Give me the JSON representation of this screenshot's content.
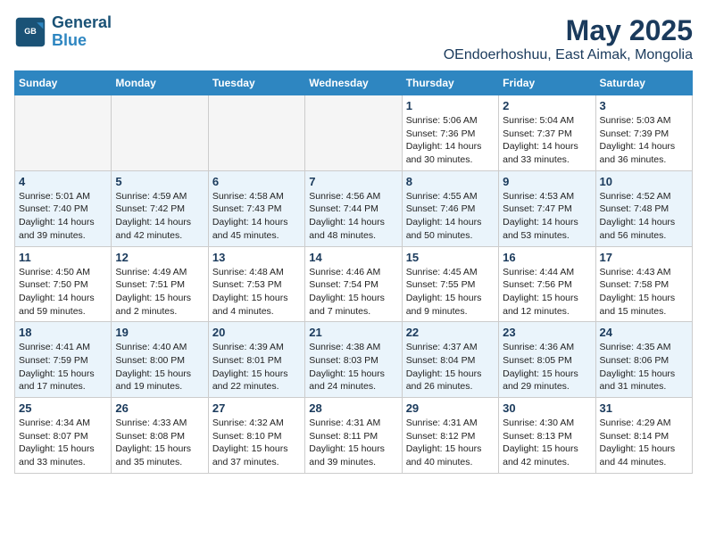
{
  "header": {
    "logo_line1": "General",
    "logo_line2": "Blue",
    "month_title": "May 2025",
    "location": "OEndoerhoshuu, East Aimak, Mongolia"
  },
  "weekdays": [
    "Sunday",
    "Monday",
    "Tuesday",
    "Wednesday",
    "Thursday",
    "Friday",
    "Saturday"
  ],
  "weeks": [
    [
      {
        "day": "",
        "info": ""
      },
      {
        "day": "",
        "info": ""
      },
      {
        "day": "",
        "info": ""
      },
      {
        "day": "",
        "info": ""
      },
      {
        "day": "1",
        "info": "Sunrise: 5:06 AM\nSunset: 7:36 PM\nDaylight: 14 hours\nand 30 minutes."
      },
      {
        "day": "2",
        "info": "Sunrise: 5:04 AM\nSunset: 7:37 PM\nDaylight: 14 hours\nand 33 minutes."
      },
      {
        "day": "3",
        "info": "Sunrise: 5:03 AM\nSunset: 7:39 PM\nDaylight: 14 hours\nand 36 minutes."
      }
    ],
    [
      {
        "day": "4",
        "info": "Sunrise: 5:01 AM\nSunset: 7:40 PM\nDaylight: 14 hours\nand 39 minutes."
      },
      {
        "day": "5",
        "info": "Sunrise: 4:59 AM\nSunset: 7:42 PM\nDaylight: 14 hours\nand 42 minutes."
      },
      {
        "day": "6",
        "info": "Sunrise: 4:58 AM\nSunset: 7:43 PM\nDaylight: 14 hours\nand 45 minutes."
      },
      {
        "day": "7",
        "info": "Sunrise: 4:56 AM\nSunset: 7:44 PM\nDaylight: 14 hours\nand 48 minutes."
      },
      {
        "day": "8",
        "info": "Sunrise: 4:55 AM\nSunset: 7:46 PM\nDaylight: 14 hours\nand 50 minutes."
      },
      {
        "day": "9",
        "info": "Sunrise: 4:53 AM\nSunset: 7:47 PM\nDaylight: 14 hours\nand 53 minutes."
      },
      {
        "day": "10",
        "info": "Sunrise: 4:52 AM\nSunset: 7:48 PM\nDaylight: 14 hours\nand 56 minutes."
      }
    ],
    [
      {
        "day": "11",
        "info": "Sunrise: 4:50 AM\nSunset: 7:50 PM\nDaylight: 14 hours\nand 59 minutes."
      },
      {
        "day": "12",
        "info": "Sunrise: 4:49 AM\nSunset: 7:51 PM\nDaylight: 15 hours\nand 2 minutes."
      },
      {
        "day": "13",
        "info": "Sunrise: 4:48 AM\nSunset: 7:53 PM\nDaylight: 15 hours\nand 4 minutes."
      },
      {
        "day": "14",
        "info": "Sunrise: 4:46 AM\nSunset: 7:54 PM\nDaylight: 15 hours\nand 7 minutes."
      },
      {
        "day": "15",
        "info": "Sunrise: 4:45 AM\nSunset: 7:55 PM\nDaylight: 15 hours\nand 9 minutes."
      },
      {
        "day": "16",
        "info": "Sunrise: 4:44 AM\nSunset: 7:56 PM\nDaylight: 15 hours\nand 12 minutes."
      },
      {
        "day": "17",
        "info": "Sunrise: 4:43 AM\nSunset: 7:58 PM\nDaylight: 15 hours\nand 15 minutes."
      }
    ],
    [
      {
        "day": "18",
        "info": "Sunrise: 4:41 AM\nSunset: 7:59 PM\nDaylight: 15 hours\nand 17 minutes."
      },
      {
        "day": "19",
        "info": "Sunrise: 4:40 AM\nSunset: 8:00 PM\nDaylight: 15 hours\nand 19 minutes."
      },
      {
        "day": "20",
        "info": "Sunrise: 4:39 AM\nSunset: 8:01 PM\nDaylight: 15 hours\nand 22 minutes."
      },
      {
        "day": "21",
        "info": "Sunrise: 4:38 AM\nSunset: 8:03 PM\nDaylight: 15 hours\nand 24 minutes."
      },
      {
        "day": "22",
        "info": "Sunrise: 4:37 AM\nSunset: 8:04 PM\nDaylight: 15 hours\nand 26 minutes."
      },
      {
        "day": "23",
        "info": "Sunrise: 4:36 AM\nSunset: 8:05 PM\nDaylight: 15 hours\nand 29 minutes."
      },
      {
        "day": "24",
        "info": "Sunrise: 4:35 AM\nSunset: 8:06 PM\nDaylight: 15 hours\nand 31 minutes."
      }
    ],
    [
      {
        "day": "25",
        "info": "Sunrise: 4:34 AM\nSunset: 8:07 PM\nDaylight: 15 hours\nand 33 minutes."
      },
      {
        "day": "26",
        "info": "Sunrise: 4:33 AM\nSunset: 8:08 PM\nDaylight: 15 hours\nand 35 minutes."
      },
      {
        "day": "27",
        "info": "Sunrise: 4:32 AM\nSunset: 8:10 PM\nDaylight: 15 hours\nand 37 minutes."
      },
      {
        "day": "28",
        "info": "Sunrise: 4:31 AM\nSunset: 8:11 PM\nDaylight: 15 hours\nand 39 minutes."
      },
      {
        "day": "29",
        "info": "Sunrise: 4:31 AM\nSunset: 8:12 PM\nDaylight: 15 hours\nand 40 minutes."
      },
      {
        "day": "30",
        "info": "Sunrise: 4:30 AM\nSunset: 8:13 PM\nDaylight: 15 hours\nand 42 minutes."
      },
      {
        "day": "31",
        "info": "Sunrise: 4:29 AM\nSunset: 8:14 PM\nDaylight: 15 hours\nand 44 minutes."
      }
    ]
  ]
}
